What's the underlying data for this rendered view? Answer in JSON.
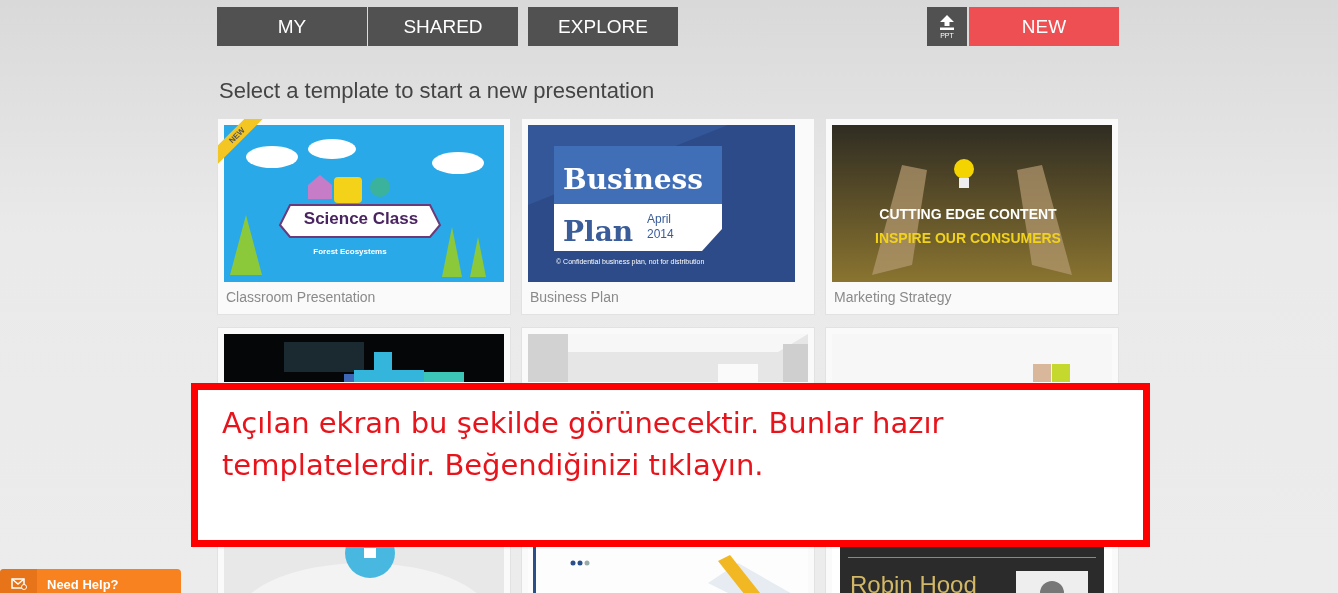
{
  "nav_buttons": [
    {
      "label": "MY"
    },
    {
      "label": "SHARED"
    },
    {
      "label": "EXPLORE"
    }
  ],
  "upload_button": {
    "label": "PPT"
  },
  "new_button": {
    "label": "NEW"
  },
  "heading": "Select a template to start a new presentation",
  "templates": [
    {
      "kind": "science",
      "title": "Classroom Presentation",
      "badge": "NEW",
      "slide_texts": [
        "Science Class",
        "Forest Ecosystems"
      ]
    },
    {
      "kind": "business",
      "title": "Business Plan",
      "slide_texts": [
        "Business",
        "Plan",
        "April",
        "2014",
        "© Confidential business plan, not for distribution"
      ]
    },
    {
      "kind": "marketing",
      "title": "Marketing Strategy",
      "slide_texts": [
        "CUTTING EDGE CONTENT",
        "INSPIRE OUR CONSUMERS"
      ]
    },
    {
      "kind": "tech"
    },
    {
      "kind": "room"
    },
    {
      "kind": "collage"
    },
    {
      "kind": "medical"
    },
    {
      "kind": "document"
    },
    {
      "kind": "resume",
      "slide_texts": [
        "Robin Hood"
      ]
    }
  ],
  "annotation": {
    "text": "Açılan ekran bu şekilde görünecektir. Bunlar hazır templatelerdir. Beğendiğinizi tıklayın."
  },
  "help_button": {
    "label": "Need Help?"
  }
}
